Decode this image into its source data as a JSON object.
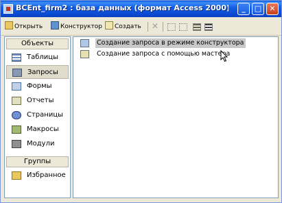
{
  "window": {
    "title": "BCEnt_firm2 : база данных (формат Access 2000)",
    "controls": {
      "minimize": "_",
      "maximize": "□",
      "close": "✕"
    }
  },
  "toolbar": {
    "open_label": "Открыть",
    "design_label": "Конструктор",
    "create_label": "Создать"
  },
  "sidebar": {
    "objects_header": "Объекты",
    "items": [
      {
        "label": "Таблицы",
        "icon": "table-icon"
      },
      {
        "label": "Запросы",
        "icon": "query-icon",
        "selected": true
      },
      {
        "label": "Формы",
        "icon": "form-icon"
      },
      {
        "label": "Отчеты",
        "icon": "report-icon"
      },
      {
        "label": "Страницы",
        "icon": "page-icon"
      },
      {
        "label": "Макросы",
        "icon": "macro-icon"
      },
      {
        "label": "Модули",
        "icon": "module-icon"
      }
    ],
    "groups_header": "Группы",
    "group_items": [
      {
        "label": "Избранное",
        "icon": "favorites-icon"
      }
    ]
  },
  "list": {
    "items": [
      {
        "label": "Создание запроса в режиме конструктора",
        "highlighted": true
      },
      {
        "label": "Создание запроса с помощью мастера"
      }
    ]
  },
  "colors": {
    "titlebar": "#0b4bd4",
    "selection": "#c8c8c8",
    "panel": "#ece9d8"
  }
}
